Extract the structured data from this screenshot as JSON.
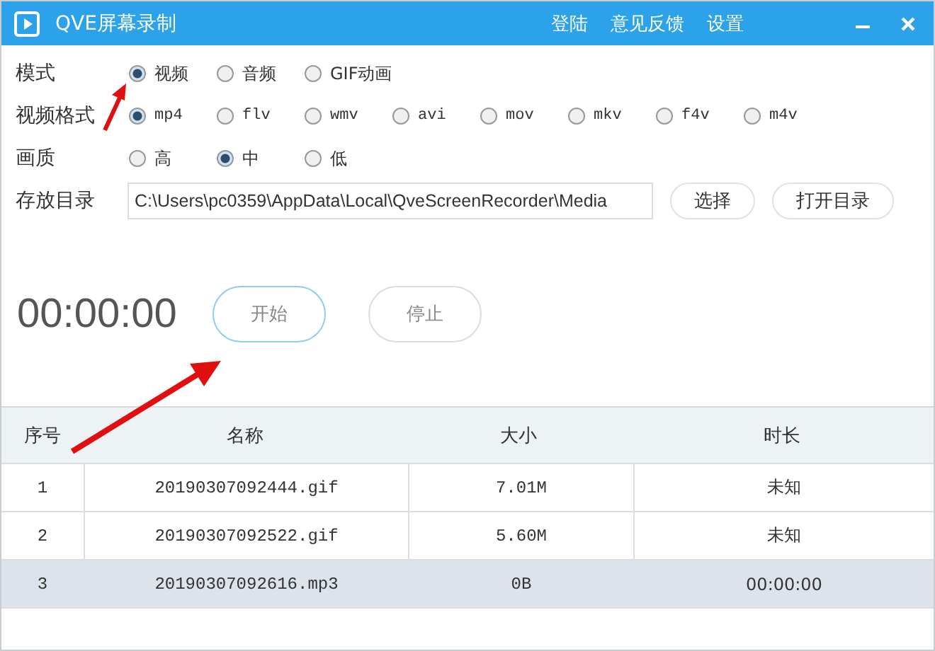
{
  "window": {
    "title": "QVE屏幕录制",
    "menu": [
      "登陆",
      "意见反馈",
      "设置"
    ]
  },
  "settings": [
    {
      "label": "模式",
      "kind": "radio",
      "options": [
        {
          "label": "视频",
          "selected": true
        },
        {
          "label": "音频",
          "selected": false
        },
        {
          "label": "GIF动画",
          "selected": false
        }
      ]
    },
    {
      "label": "视频格式",
      "kind": "radio",
      "options": [
        {
          "label": "mp4",
          "selected": true
        },
        {
          "label": "flv",
          "selected": false
        },
        {
          "label": "wmv",
          "selected": false
        },
        {
          "label": "avi",
          "selected": false
        },
        {
          "label": "mov",
          "selected": false
        },
        {
          "label": "mkv",
          "selected": false
        },
        {
          "label": "f4v",
          "selected": false
        },
        {
          "label": "m4v",
          "selected": false
        }
      ]
    },
    {
      "label": "画质",
      "kind": "radio",
      "options": [
        {
          "label": "高",
          "selected": false
        },
        {
          "label": "中",
          "selected": true
        },
        {
          "label": "低",
          "selected": false
        }
      ]
    },
    {
      "label": "存放目录",
      "kind": "path",
      "value": "C:\\Users\\pc0359\\AppData\\Local\\QveScreenRecorder\\Media",
      "buttons": [
        "选择",
        "打开目录"
      ]
    }
  ],
  "timer": "00:00:00",
  "controls": [
    "开始",
    "停止"
  ],
  "table": {
    "columns": [
      "序号",
      "名称",
      "大小",
      "时长"
    ],
    "rows": [
      {
        "cells": [
          "1",
          "20190307092444.gif",
          "7.01M",
          "未知"
        ],
        "selected": false
      },
      {
        "cells": [
          "2",
          "20190307092522.gif",
          "5.60M",
          "未知"
        ],
        "selected": false
      },
      {
        "cells": [
          "3",
          "20190307092616.mp3",
          "0B",
          "00:00:00"
        ],
        "selected": true
      }
    ]
  }
}
